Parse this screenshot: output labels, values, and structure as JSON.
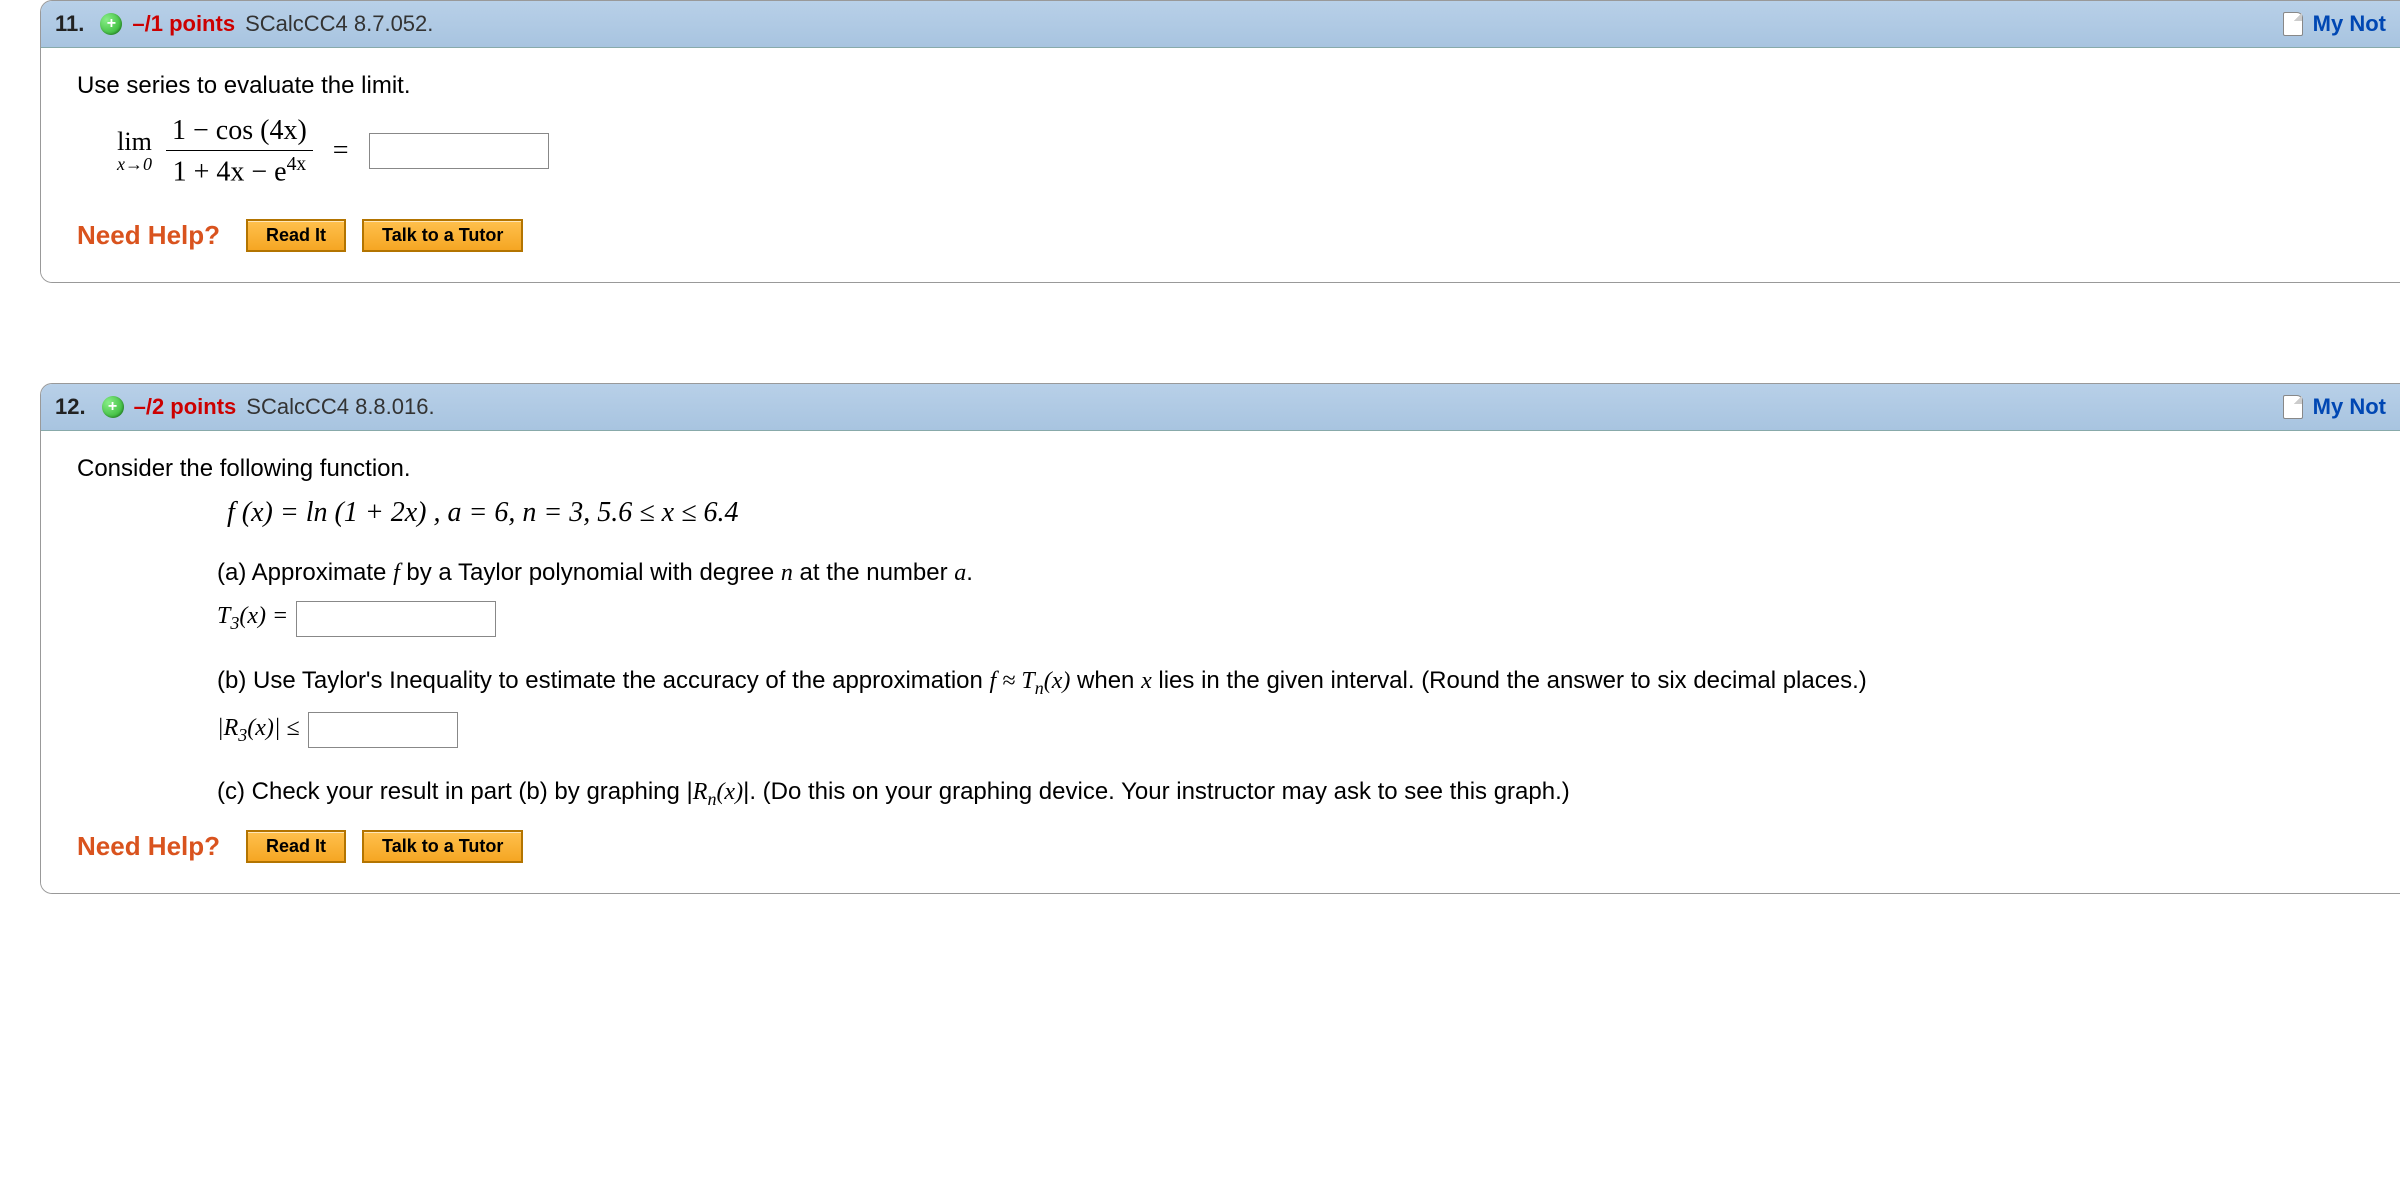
{
  "q11": {
    "number": "11.",
    "points": "–/1 points",
    "source": "SCalcCC4 8.7.052.",
    "my_notes": "My Not",
    "prompt": "Use series to evaluate the limit.",
    "lim_label": "lim",
    "lim_sub": "x→0",
    "frac_num": "1 − cos (4x)",
    "frac_den_pre": "1 + 4x − e",
    "frac_den_sup": "4x",
    "equals": "=",
    "need_help": "Need Help?",
    "read_it": "Read It",
    "talk_tutor": "Talk to a Tutor"
  },
  "q12": {
    "number": "12.",
    "points": "–/2 points",
    "source": "SCalcCC4 8.8.016.",
    "my_notes": "My Not",
    "prompt": "Consider the following function.",
    "fn_def": "f (x) = ln (1  +  2x) , a = 6, n = 3, 5.6 ≤ x ≤ 6.4",
    "part_a_text_1": "(a) Approximate ",
    "part_a_text_2": " by a Taylor polynomial with degree ",
    "part_a_text_3": " at the number ",
    "part_a_label_pre": "T",
    "part_a_label_sub": "3",
    "part_a_label_post": "(x) =",
    "part_b_text_1": "(b) Use Taylor's Inequality to estimate the accuracy of the approximation ",
    "part_b_text_2": " when ",
    "part_b_text_3": " lies in the given interval. (Round the answer to six decimal places.)",
    "part_b_approx_f": "f ≈ T",
    "part_b_approx_n": "n",
    "part_b_approx_x": "(x)",
    "part_b_label_pre": "|R",
    "part_b_label_sub": "3",
    "part_b_label_post": "(x)| ≤",
    "part_c_text_1": "(c) Check your result in part (b) by graphing |",
    "part_c_text_2": "|. (Do this on your graphing device. Your instructor may ask to see this graph.)",
    "part_c_rn_pre": "R",
    "part_c_rn_sub": "n",
    "part_c_rn_post": "(x)",
    "need_help": "Need Help?",
    "read_it": "Read It",
    "talk_tutor": "Talk to a Tutor"
  },
  "letters": {
    "f": "f",
    "n": "n",
    "a": "a",
    "x": "x",
    "dot": "."
  }
}
